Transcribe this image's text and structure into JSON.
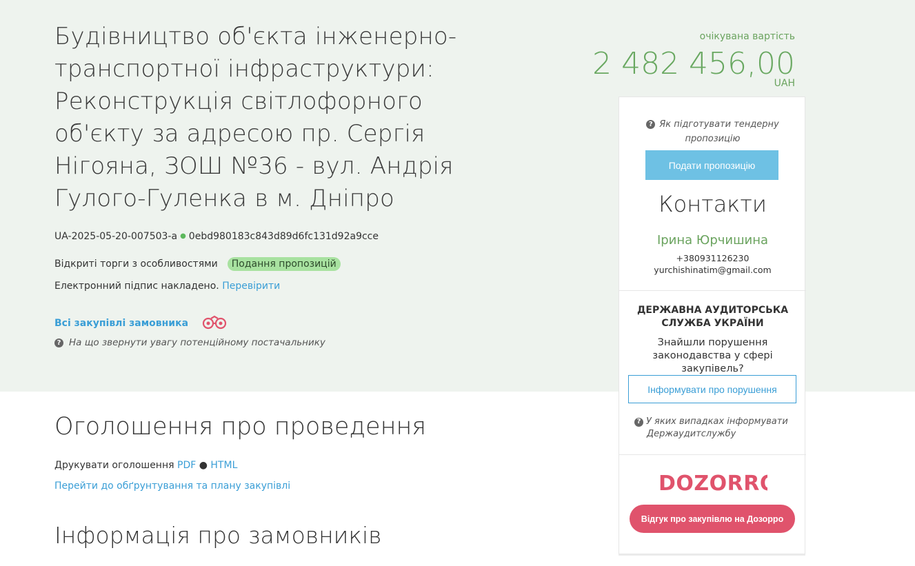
{
  "tender": {
    "title": "Будівництво об'єкта інженерно-транспортної інфраструктури: Реконструкція світлофорного об'єкту за адресою пр. Сергія Нігояна, ЗОШ №36 - вул. Андрія Гулого-Гуленка в м. Дніпро",
    "id": "UA-2025-05-20-007503-a",
    "hash": "0ebd980183c843d89d6fc131d92a9cce",
    "procedure": "Відкриті торги з особливостями",
    "status": "Подання пропозицій",
    "signature_text": "Електронний підпис накладено.",
    "signature_link": "Перевірити",
    "all_buyer_link": "Всі закупівлі замовника",
    "attention_text": "На що звернути увагу потенційному постачальнику"
  },
  "price": {
    "label": "очікувана вартість",
    "value": "2 482 456,00",
    "currency": "UAH"
  },
  "sidebar": {
    "howto_text": "Як підготувати тендерну пропозицію",
    "submit_button": "Подати пропозицію",
    "contacts_title": "Контакти",
    "contact_name": "Ірина Юрчишина",
    "contact_phone": "+380931126230",
    "contact_email": "yurchishinatim@gmail.com",
    "dasu_title": "ДЕРЖАВНА АУДИТОРСЬКА СЛУЖБА УКРАЇНИ",
    "dasu_text": "Знайшли порушення законодавства у сфері закупівель?",
    "inform_button": "Інформувати про порушення",
    "cases_line1": "У яких випадках інформувати",
    "cases_line2": "Держаудитслужбу",
    "dozorro_logo_text": "DOZORRO",
    "dozorro_button": "Відгук про закупівлю на Дозорро"
  },
  "main": {
    "announce_title": "Оголошення про проведення",
    "print_label": "Друкувати оголошення",
    "print_pdf": "PDF",
    "print_sep": "●",
    "print_html": "HTML",
    "goto_plan": "Перейти до обґрунтування та плану закупівлі",
    "buyers_title": "Інформація про замовників"
  },
  "colors": {
    "hero_bg": "#eef3ee",
    "accent_green": "#69a861",
    "link_blue": "#3a9ed6",
    "submit_blue": "#6ec1e4",
    "dozorro_red": "#e0536c",
    "status_badge_bg": "#a8e2a0"
  }
}
